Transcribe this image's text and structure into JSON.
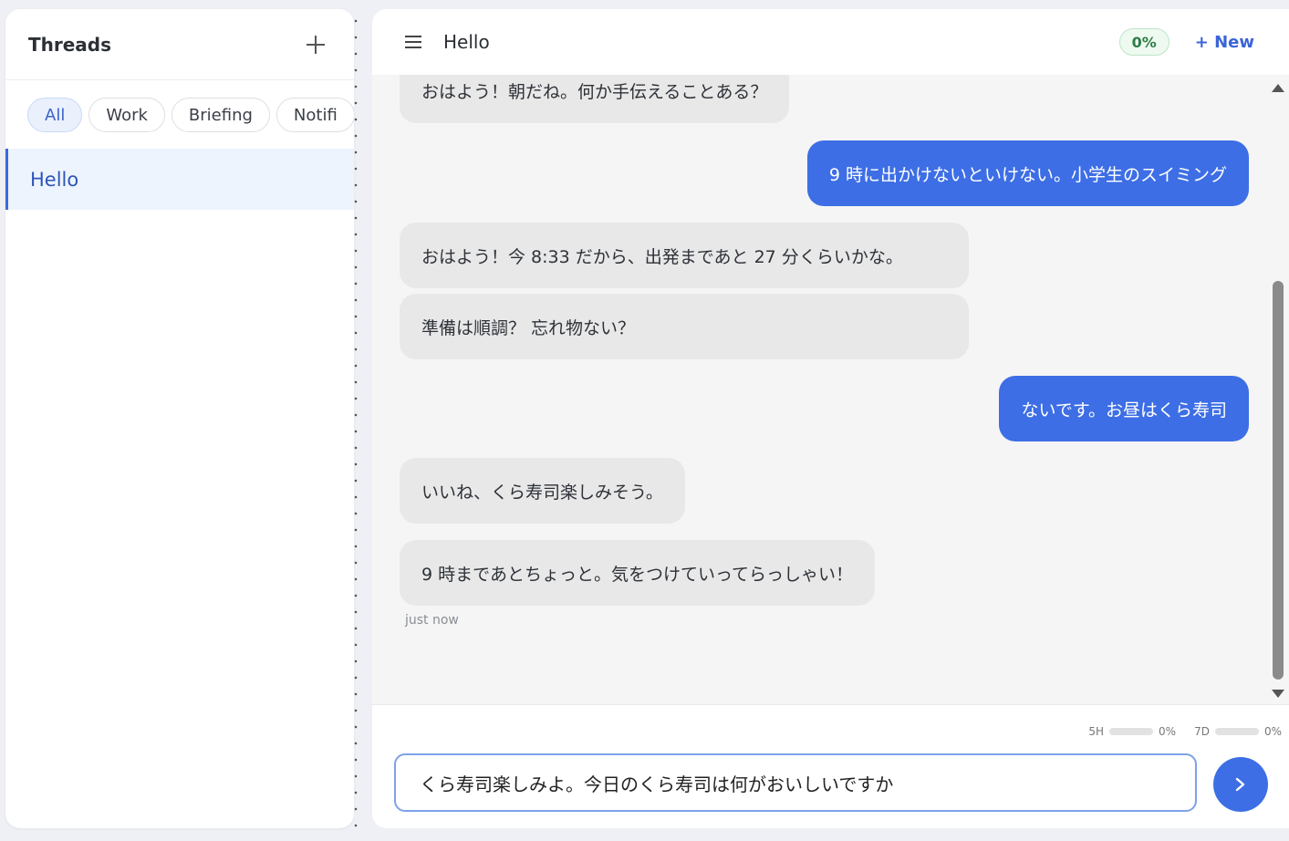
{
  "sidebar": {
    "title": "Threads",
    "add_icon": "plus-icon",
    "filters": [
      {
        "label": "All",
        "active": true
      },
      {
        "label": "Work",
        "active": false
      },
      {
        "label": "Briefing",
        "active": false
      },
      {
        "label": "Notifi",
        "active": false
      }
    ],
    "threads": [
      {
        "title": "Hello",
        "selected": true
      }
    ]
  },
  "header": {
    "menu_icon": "hamburger-menu-icon",
    "title": "Hello",
    "context_percent": "0%",
    "new_button": "+ New"
  },
  "messages": [
    {
      "role": "bot",
      "text": "おはよう！朝だね。何か手伝えることある？"
    },
    {
      "role": "user",
      "text": "9 時に出かけないといけない。小学生のスイミング"
    },
    {
      "role": "bot",
      "text": "おはよう！今 8:33 だから、出発まであと 27 分くらいかな。"
    },
    {
      "role": "bot",
      "text": "準備は順調？ 忘れ物ない？"
    },
    {
      "role": "user",
      "text": "ないです。お昼はくら寿司"
    },
    {
      "role": "bot",
      "text": "いいね、くら寿司楽しみそう。"
    },
    {
      "role": "bot",
      "text": "9 時まであとちょっと。気をつけていってらっしゃい！"
    }
  ],
  "timestamp": "just now",
  "usage": {
    "five_hour": {
      "label": "5H",
      "value": "0%",
      "fraction": 0
    },
    "seven_day": {
      "label": "7D",
      "value": "0%",
      "fraction": 0
    }
  },
  "composer": {
    "value": "くら寿司楽しみよ。今日のくら寿司は何がおいしいですか",
    "send_icon": "chevron-right-icon"
  },
  "colors": {
    "accent": "#3d6ee5",
    "bot_bubble": "#e8e8e8",
    "badge_green": "#2e7d46"
  }
}
